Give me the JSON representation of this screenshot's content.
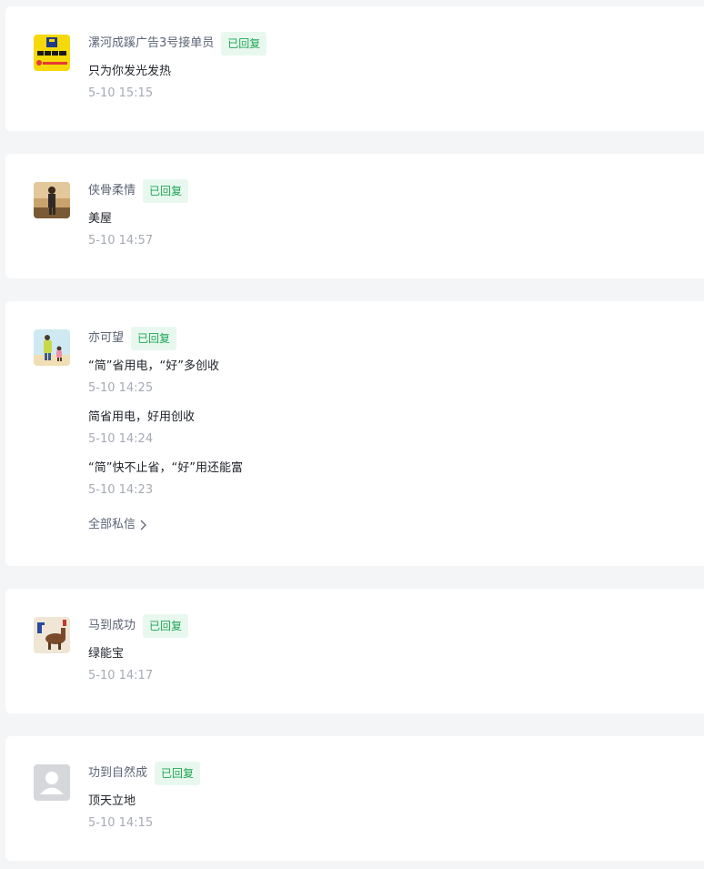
{
  "cards": [
    {
      "name": "漯河成蹊广告3号接单员",
      "badge": "已回复",
      "avatar": "company-logo-avatar",
      "messages": [
        {
          "text": "只为你发光发热",
          "time": "5-10 15:15"
        }
      ]
    },
    {
      "name": "侠骨柔情",
      "badge": "已回复",
      "avatar": "person-photo-avatar",
      "messages": [
        {
          "text": "美屋",
          "time": "5-10 14:57"
        }
      ]
    },
    {
      "name": "亦可望",
      "badge": "已回复",
      "avatar": "parent-child-illustration-avatar",
      "messages": [
        {
          "text": "“简”省用电，“好”多创收",
          "time": "5-10 14:25"
        },
        {
          "text": "简省用电，好用创收",
          "time": "5-10 14:24"
        },
        {
          "text": "“简”快不止省，“好”用还能富",
          "time": "5-10 14:23"
        }
      ],
      "more_label": "全部私信"
    },
    {
      "name": "马到成功",
      "badge": "已回复",
      "avatar": "horse-painting-avatar",
      "messages": [
        {
          "text": "绿能宝",
          "time": "5-10 14:17"
        }
      ]
    },
    {
      "name": "功到自然成",
      "badge": "已回复",
      "avatar": "default-user-avatar",
      "messages": [
        {
          "text": "顶天立地",
          "time": "5-10 14:15"
        }
      ]
    }
  ],
  "colors": {
    "page_background": "#f4f5f7",
    "badge_background": "#e8f8ef",
    "badge_text": "#1fa653",
    "name_text": "#5c6475",
    "message_text": "#1f2329",
    "time_text": "#a6abb5"
  }
}
